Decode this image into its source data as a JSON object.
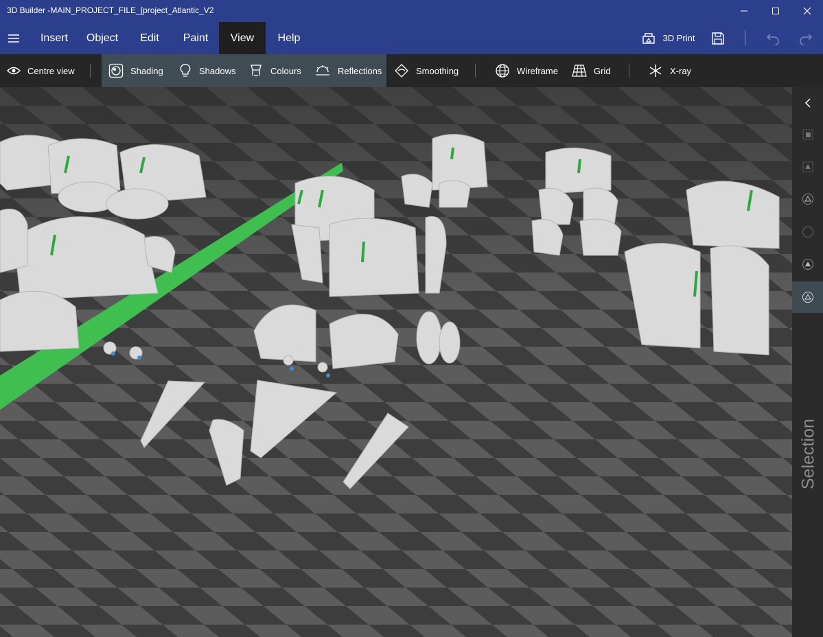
{
  "app": {
    "title": "3D Builder -MAIN_PROJECT_FILE_[project_Atlantic_V2"
  },
  "window_controls": {
    "minimize": "minimize-icon",
    "maximize": "maximize-icon",
    "close": "close-icon"
  },
  "menu": {
    "items": [
      {
        "label": "Insert",
        "active": false
      },
      {
        "label": "Object",
        "active": false
      },
      {
        "label": "Edit",
        "active": false
      },
      {
        "label": "Paint",
        "active": false
      },
      {
        "label": "View",
        "active": true
      },
      {
        "label": "Help",
        "active": false
      }
    ],
    "print_label": "3D Print",
    "save_icon": "save-icon",
    "undo_icon": "undo-icon",
    "redo_icon": "redo-icon"
  },
  "toolbar": {
    "centre_view": "Centre view",
    "shading": "Shading",
    "shadows": "Shadows",
    "colours": "Colours",
    "reflections": "Reflections",
    "smoothing": "Smoothing",
    "wireframe": "Wireframe",
    "grid": "Grid",
    "xray": "X-ray",
    "active_toggles": [
      "Shading",
      "Shadows",
      "Colours",
      "Reflections"
    ]
  },
  "right_panel": {
    "label": "Selection",
    "buttons": [
      "collapse-panel-icon",
      "select-objects-icon",
      "select-faces-icon",
      "select-edges-icon",
      "select-vertices-icon",
      "select-mesh-icon",
      "select-triangles-icon"
    ],
    "active_button": "select-triangles-icon"
  },
  "colors": {
    "title_bar": "#2b3f8c",
    "toolbar": "#262626",
    "toolbar_highlight": "#3f4c53",
    "grid_dark": "#3d3d3d",
    "grid_light": "#5a5a5a",
    "rail": "#3fbf4f",
    "parts": "#d9d9d9"
  }
}
